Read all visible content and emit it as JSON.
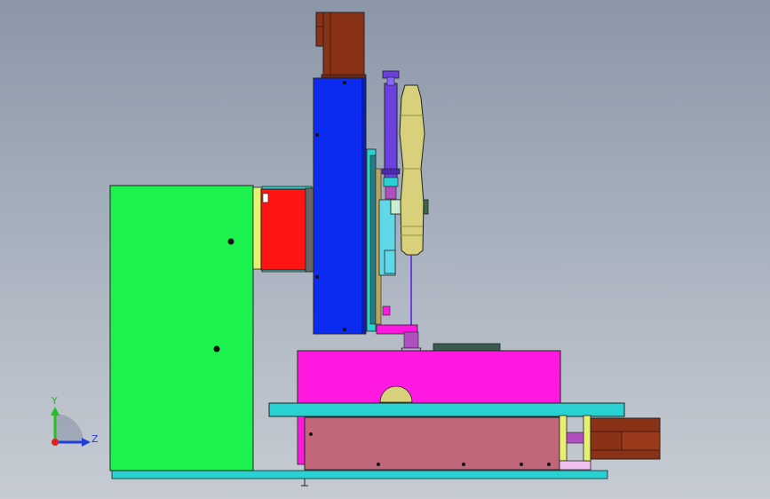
{
  "viewport": {
    "background_top": "#8b97a8",
    "background_bottom": "#c7ccd3"
  },
  "triad": {
    "y_label": "Y",
    "z_label": "Z",
    "y_color": "#22c022",
    "z_color": "#1f3fd6",
    "origin_color": "#e02020"
  },
  "colors": {
    "frame": "#1cf24d",
    "column": "#0b2cf0",
    "motor": "#8a3218",
    "bracket": "#ff1414",
    "table": "#ff19e0",
    "rail": "#28d2d2",
    "base": "#c0687a",
    "cylinder": "#6b3fe0",
    "horn": "#d8d07a",
    "bar": "#5fd8e8"
  }
}
